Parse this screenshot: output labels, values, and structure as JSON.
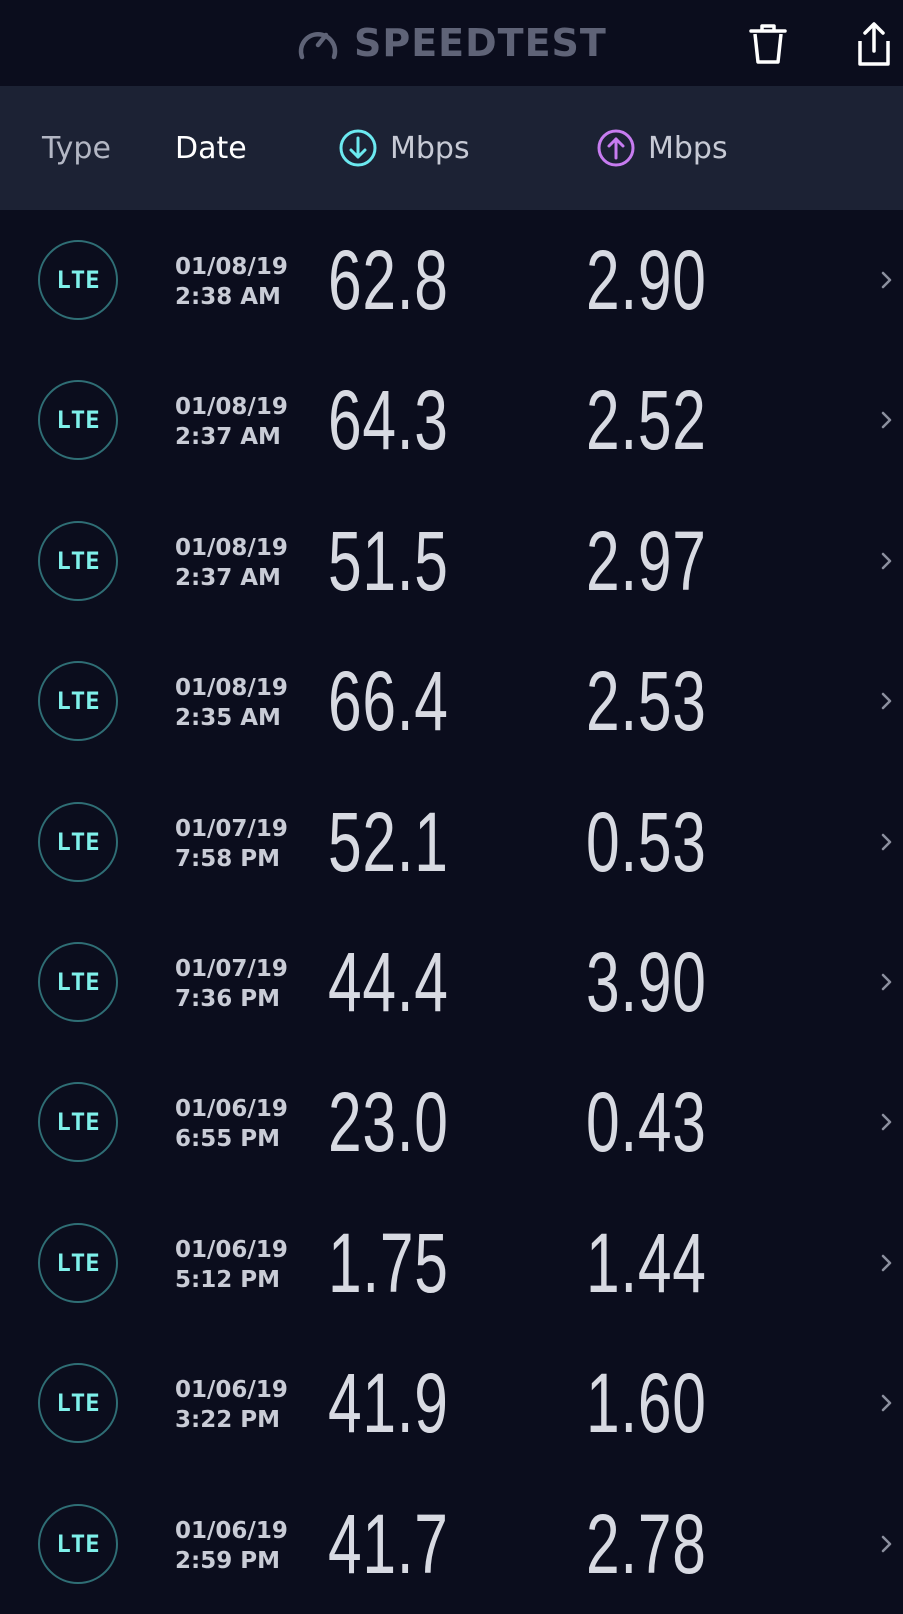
{
  "app": {
    "brand": "SPEEDTEST"
  },
  "header": {
    "type_label": "Type",
    "date_label": "Date",
    "download_label": "Mbps",
    "upload_label": "Mbps"
  },
  "colors": {
    "background": "#0b0d1d",
    "header_bg": "#1c2234",
    "download_accent": "#6ce9f0",
    "upload_accent": "#c77cf0",
    "badge_text": "#7ff0ea"
  },
  "rows": [
    {
      "type": "LTE",
      "date": "01/08/19",
      "time": "2:38 AM",
      "download": "62.8",
      "upload": "2.90"
    },
    {
      "type": "LTE",
      "date": "01/08/19",
      "time": "2:37 AM",
      "download": "64.3",
      "upload": "2.52"
    },
    {
      "type": "LTE",
      "date": "01/08/19",
      "time": "2:37 AM",
      "download": "51.5",
      "upload": "2.97"
    },
    {
      "type": "LTE",
      "date": "01/08/19",
      "time": "2:35 AM",
      "download": "66.4",
      "upload": "2.53"
    },
    {
      "type": "LTE",
      "date": "01/07/19",
      "time": "7:58 PM",
      "download": "52.1",
      "upload": "0.53"
    },
    {
      "type": "LTE",
      "date": "01/07/19",
      "time": "7:36 PM",
      "download": "44.4",
      "upload": "3.90"
    },
    {
      "type": "LTE",
      "date": "01/06/19",
      "time": "6:55 PM",
      "download": "23.0",
      "upload": "0.43"
    },
    {
      "type": "LTE",
      "date": "01/06/19",
      "time": "5:12 PM",
      "download": "1.75",
      "upload": "1.44"
    },
    {
      "type": "LTE",
      "date": "01/06/19",
      "time": "3:22 PM",
      "download": "41.9",
      "upload": "1.60"
    },
    {
      "type": "LTE",
      "date": "01/06/19",
      "time": "2:59 PM",
      "download": "41.7",
      "upload": "2.78"
    }
  ]
}
